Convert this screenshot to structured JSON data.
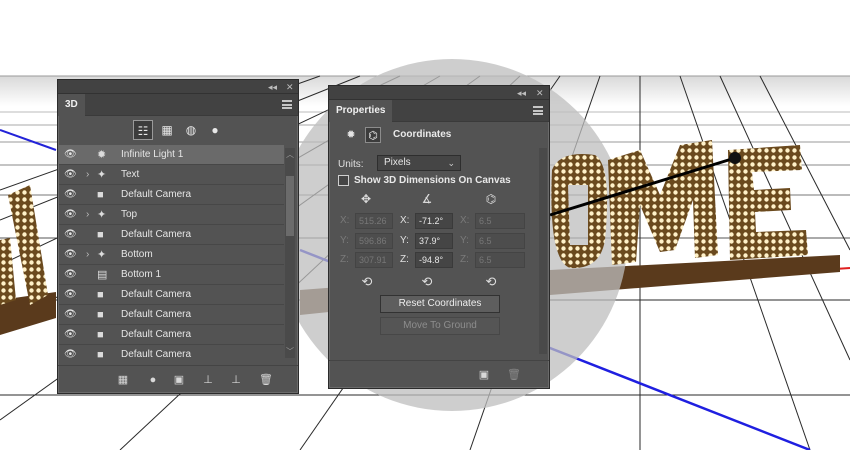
{
  "window_controls": {
    "collapse": "◂◂",
    "close": "✕"
  },
  "panel3d": {
    "tab": "3D",
    "toolbar_icons": [
      "scene-filter-icon",
      "mesh-filter-icon",
      "material-filter-icon",
      "light-filter-icon"
    ],
    "rows": [
      {
        "label": "Infinite Light 1",
        "icon": "light-icon",
        "expandable": false,
        "selected": true
      },
      {
        "label": "Text",
        "icon": "mesh-icon",
        "expandable": true,
        "selected": false
      },
      {
        "label": "Default Camera",
        "icon": "camera-icon",
        "expandable": false,
        "selected": false
      },
      {
        "label": "Top",
        "icon": "mesh-icon",
        "expandable": true,
        "selected": false
      },
      {
        "label": "Default Camera",
        "icon": "camera-icon",
        "expandable": false,
        "selected": false
      },
      {
        "label": "Bottom",
        "icon": "mesh-icon",
        "expandable": true,
        "selected": false
      },
      {
        "label": "Bottom 1",
        "icon": "object-icon",
        "expandable": false,
        "selected": false
      },
      {
        "label": "Default Camera",
        "icon": "camera-icon",
        "expandable": false,
        "selected": false
      },
      {
        "label": "Default Camera",
        "icon": "camera-icon",
        "expandable": false,
        "selected": false
      },
      {
        "label": "Default Camera",
        "icon": "camera-icon",
        "expandable": false,
        "selected": false
      },
      {
        "label": "Default Camera",
        "icon": "camera-icon",
        "expandable": false,
        "selected": false
      }
    ],
    "bottom_icons": [
      "mesh-icon",
      "add-light-icon",
      "render-icon",
      "ground-icon",
      "drop-icon",
      "trash-icon"
    ]
  },
  "properties": {
    "tab": "Properties",
    "section_title": "Coordinates",
    "units_label": "Units:",
    "units_value": "Pixels",
    "show_dimensions_label": "Show 3D Dimensions On Canvas",
    "position": {
      "x": "515.26",
      "y": "596.86",
      "z": "307.91"
    },
    "rotation": {
      "x": "-71.2°",
      "y": "37.9°",
      "z": "-94.8°"
    },
    "scale": {
      "x": "6.5",
      "y": "6.5",
      "z": "6.5"
    },
    "axis_labels": {
      "x": "X:",
      "y": "Y:",
      "z": "Z:"
    },
    "reset_button": "Reset Coordinates",
    "ground_button": "Move To Ground"
  },
  "colors": {
    "panel_bg": "#535353",
    "panel_dark": "#424242",
    "selected_row": "#6a6a6a",
    "axis_blue": "#1f1fe0",
    "axis_red": "#e02020"
  }
}
